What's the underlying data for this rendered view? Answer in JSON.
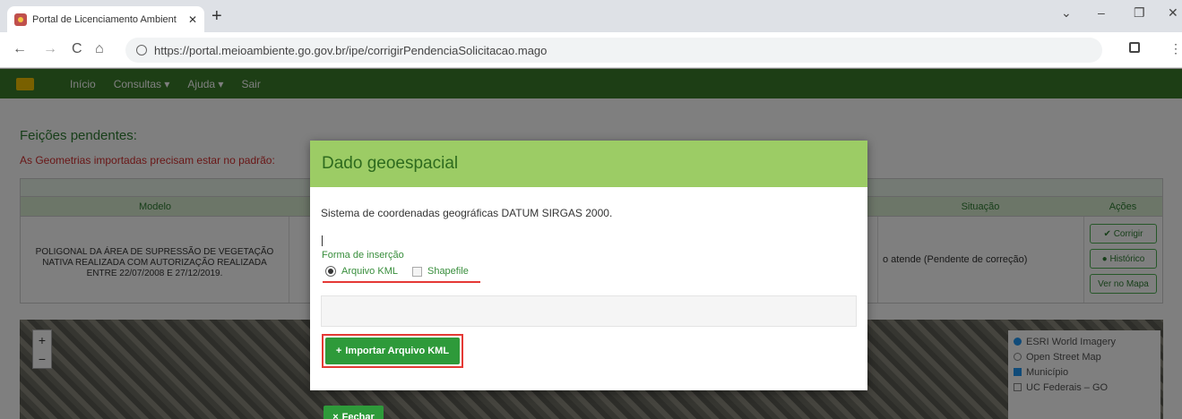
{
  "browser": {
    "tab_title": "Portal de Licenciamento Ambient",
    "tab_close": "✕",
    "new_tab": "+",
    "url": "https://portal.meioambiente.go.gov.br/ipe/corrigirPendenciaSolicitacao.mago",
    "controls": {
      "dropdown": "⌄",
      "minimize": "–",
      "restore": "❐",
      "close": "✕"
    },
    "nav": {
      "back": "←",
      "forward": "→",
      "reload": "C",
      "home": "⌂"
    },
    "menu": "⋮"
  },
  "app_nav": {
    "items": [
      "Início",
      "Consultas ▾",
      "Ajuda ▾",
      "Sair"
    ]
  },
  "page": {
    "title": "Feições pendentes:",
    "warning": "As Geometrias importadas precisam estar no padrão:",
    "table": {
      "headers": {
        "modelo": "Modelo",
        "situacao": "Situação",
        "acoes": "Ações"
      },
      "row": {
        "modelo": "POLIGONAL DA ÁREA DE SUPRESSÃO DE VEGETAÇÃO NATIVA REALIZADA COM AUTORIZAÇÃO REALIZADA ENTRE 22/07/2008 E 27/12/2019.",
        "situacao": "o atende (Pendente de correção)",
        "actions": [
          "✔ Corrigir",
          "● Histórico",
          "Ver no Mapa"
        ]
      }
    },
    "map": {
      "zoom_in": "+",
      "zoom_out": "−",
      "layers": [
        {
          "label": "ESRI World Imagery",
          "type": "radio",
          "checked": true
        },
        {
          "label": "Open Street Map",
          "type": "radio",
          "checked": false
        },
        {
          "label": "Município",
          "type": "checkbox",
          "checked": true
        },
        {
          "label": "UC Federais – GO",
          "type": "checkbox",
          "checked": false
        }
      ]
    }
  },
  "modal": {
    "title": "Dado geoespacial",
    "system_text": "Sistema de coordenadas geográficas DATUM SIRGAS 2000.",
    "insertion_label": "Forma de inserção",
    "option_kml": "Arquivo KML",
    "option_shapefile": "Shapefile",
    "import_button": "Importar Arquivo KML",
    "import_icon": "+",
    "close_button": "Fechar",
    "close_icon": "×"
  },
  "colors": {
    "modal_header": "#9ccc65",
    "button_green": "#2e9a3a",
    "highlight_red": "#e53935"
  }
}
